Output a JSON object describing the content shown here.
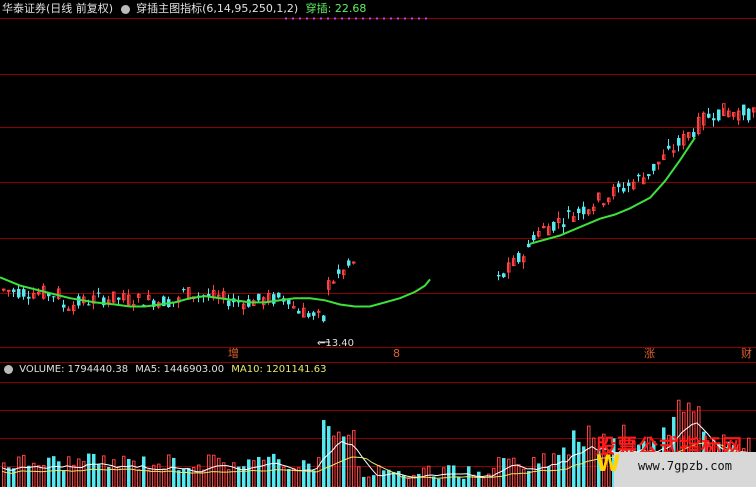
{
  "header": {
    "stock": "华泰证券(日线 前复权)",
    "indicator": "穿插主图指标(6,14,95,250,1,2)",
    "indicator_value": "穿插: 22.68"
  },
  "volume_header": {
    "volume": "VOLUME: 1794440.38",
    "ma5": "MA5: 1446903.00",
    "ma10": "MA10: 1201141.63"
  },
  "annotations": {
    "low_label": "13.40",
    "zeng": "增",
    "zhang": "涨",
    "cai": "财",
    "marker": "8"
  },
  "watermark": {
    "text": "股票公式指标网",
    "url": "www.7gpzb.com",
    "w": "W"
  },
  "colors": {
    "up": "#ff4040",
    "down": "#54e8f0",
    "line": "#3ee03e",
    "grid": "#8b0000"
  },
  "chart_data": [
    {
      "type": "candlestick",
      "title": "华泰证券(日线 前复权)",
      "series": [
        {
          "name": "穿插",
          "values": [
            16.0,
            15.6,
            15.3,
            15.0,
            14.8,
            14.7,
            14.6,
            14.6,
            14.7,
            14.8,
            15.0,
            15.1,
            15.0,
            14.9,
            14.8,
            14.8,
            14.9,
            15.0,
            15.0,
            14.9,
            14.7,
            14.6,
            14.6,
            14.8,
            15.0,
            15.3,
            15.6,
            15.9,
            16.2,
            17.6,
            17.8,
            18.0,
            18.4,
            18.8,
            19.0,
            19.3,
            19.8,
            20.6,
            21.6,
            22.68
          ]
        }
      ],
      "low_annotation": 13.4
    },
    {
      "type": "bar",
      "title": "VOLUME",
      "series": [
        {
          "name": "VOLUME",
          "last": 1794440.38
        },
        {
          "name": "MA5",
          "last": 1446903.0
        },
        {
          "name": "MA10",
          "last": 1201141.63
        }
      ]
    }
  ]
}
